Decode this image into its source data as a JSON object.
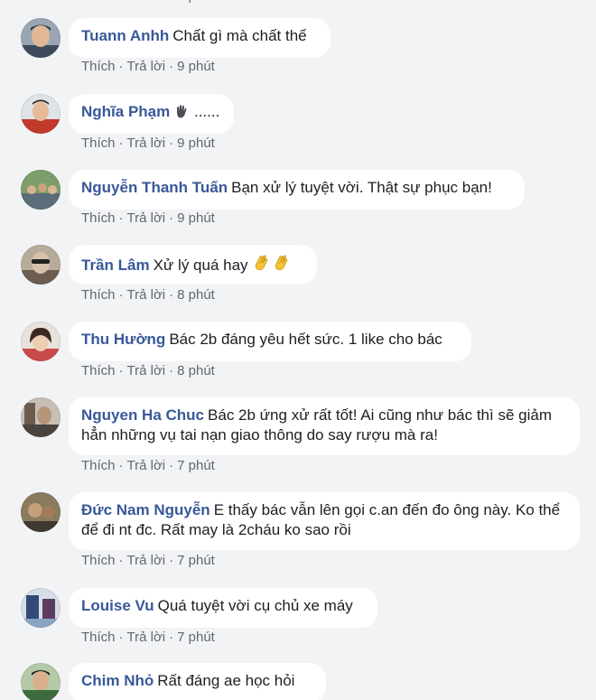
{
  "actions": {
    "like_label": "Thích",
    "reply_label": "Trả lời",
    "separator": "·"
  },
  "comments": [
    {
      "author": "Tuann Anhh",
      "text": "Chất gì mà chất thế",
      "time": "9 phút"
    },
    {
      "author": "Nghĩa Phạm",
      "text": " ......",
      "time": "9 phút",
      "author_icon": "waving-hand-icon"
    },
    {
      "author": "Nguyễn Thanh Tuấn",
      "text": "Bạn xử lý tuyệt vời. Thật sự phục bạn!",
      "time": "9 phút"
    },
    {
      "author": "Trần Lâm",
      "text": "Xử lý quá hay",
      "time": "8 phút",
      "trailing_icons": [
        "clapping-hands-icon",
        "clapping-hands-icon"
      ]
    },
    {
      "author": "Thu Hường",
      "text": "Bác 2b đáng yêu hết sức. 1 like cho bác",
      "time": "8 phút"
    },
    {
      "author": "Nguyen Ha Chuc",
      "text": "Bác 2b ứng xử rất tốt! Ai cũng như bác thì sẽ giảm hẳn những vụ tai nạn giao thông do say rượu mà ra!",
      "time": "7 phút"
    },
    {
      "author": "Đức Nam Nguyễn",
      "text": "E thấy bác vẫn lên gọi c.an đến đo ông này. Ko thể để đi nt đc. Rất may là 2cháu ko sao rồi",
      "time": "7 phút"
    },
    {
      "author": "Louise Vu",
      "text": "Quá tuyệt vời cụ chủ xe máy",
      "time": "7 phút"
    },
    {
      "author": "Chim Nhỏ",
      "text": "Rất đáng ae học hỏi",
      "time": ""
    }
  ],
  "colors": {
    "author": "#385898",
    "text": "#1c1e21",
    "meta": "#606770",
    "bubble": "#ffffff",
    "page_background": "#f2f3f5"
  }
}
